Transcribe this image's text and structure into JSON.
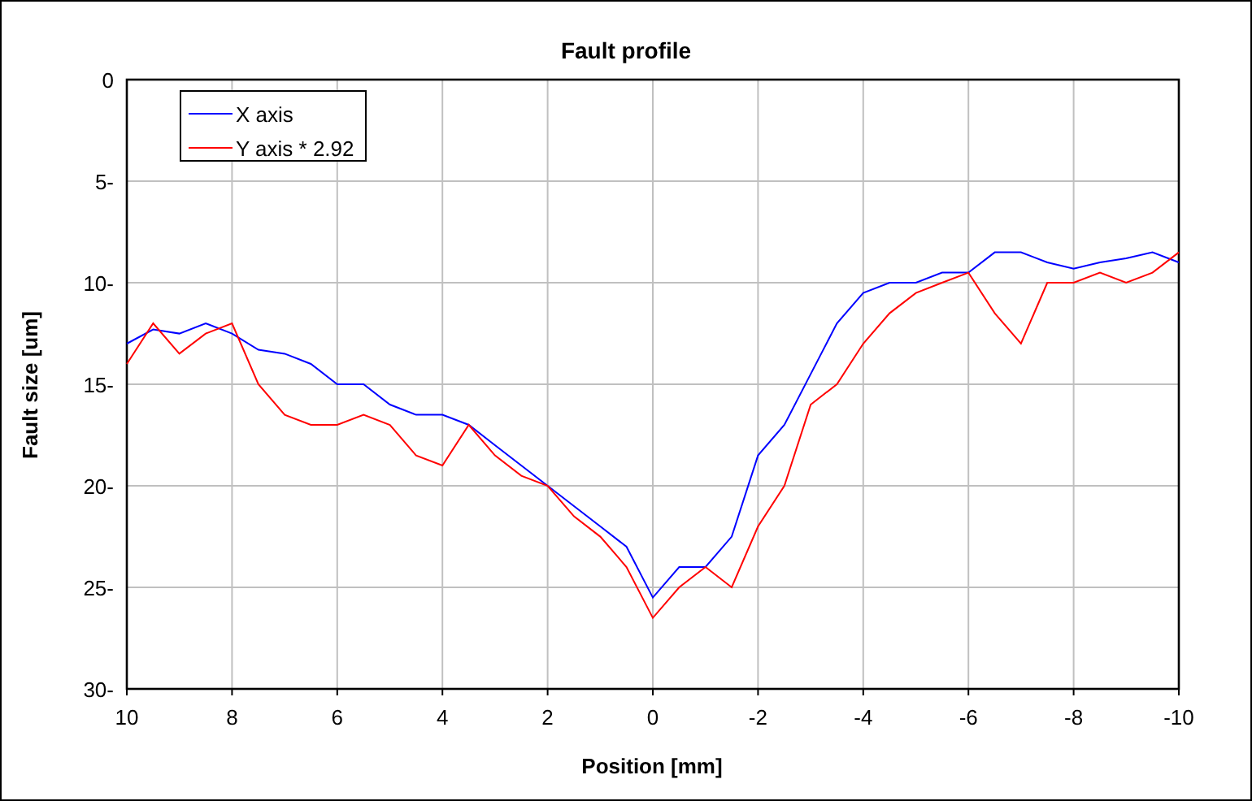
{
  "chart": {
    "chart_data": {
      "type": "line",
      "title": "Fault profile",
      "xlabel": "Position [mm]",
      "ylabel": "Fault size [um]",
      "x": [
        10,
        9.5,
        9,
        8.5,
        8,
        7.5,
        7,
        6.5,
        6,
        5.5,
        5,
        4.5,
        4,
        3.5,
        3,
        2.5,
        2,
        1.5,
        1,
        0.5,
        0,
        -0.5,
        -1,
        -1.5,
        -2,
        -2.5,
        -3,
        -3.5,
        -4,
        -4.5,
        -5,
        -5.5,
        -6,
        -6.5,
        -7,
        -7.5,
        -8,
        -8.5,
        -9,
        -9.5,
        -10
      ],
      "series": [
        {
          "name": "X axis",
          "color": "#0000ff",
          "values": [
            13,
            12.3,
            12.5,
            12,
            12.5,
            13.3,
            13.5,
            14,
            15,
            15,
            16,
            16.5,
            16.5,
            17,
            18,
            19,
            20,
            21,
            22,
            23,
            25.5,
            24,
            24,
            22.5,
            18.5,
            17,
            14.5,
            12,
            10.5,
            10,
            10,
            9.5,
            9.5,
            8.5,
            8.5,
            9,
            9.3,
            9,
            8.8,
            8.5,
            9
          ]
        },
        {
          "name": "Y axis * 2.92",
          "color": "#ff0000",
          "values": [
            14,
            12,
            13.5,
            12.5,
            12,
            15,
            16.5,
            17,
            17,
            16.5,
            17,
            18.5,
            19,
            17,
            18.5,
            19.5,
            20,
            21.5,
            22.5,
            24,
            26.5,
            25,
            24,
            25,
            22,
            20,
            16,
            15,
            13,
            11.5,
            10.5,
            10,
            9.5,
            11.5,
            13,
            10,
            10,
            9.5,
            10,
            9.5,
            8.5
          ]
        }
      ],
      "grid": true,
      "legend": true,
      "xlim": [
        10,
        -10
      ],
      "ylim": [
        30,
        0
      ],
      "xticks": [
        10,
        8,
        6,
        4,
        2,
        0,
        -2,
        -4,
        -6,
        -8,
        -10
      ],
      "yticks": [
        {
          "value": 0,
          "label": "0"
        },
        {
          "value": 5,
          "label": "5-"
        },
        {
          "value": 10,
          "label": "10-"
        },
        {
          "value": 15,
          "label": "15-"
        },
        {
          "value": 20,
          "label": "20-"
        },
        {
          "value": 25,
          "label": "25-"
        },
        {
          "value": 30,
          "label": "30-"
        }
      ]
    }
  }
}
